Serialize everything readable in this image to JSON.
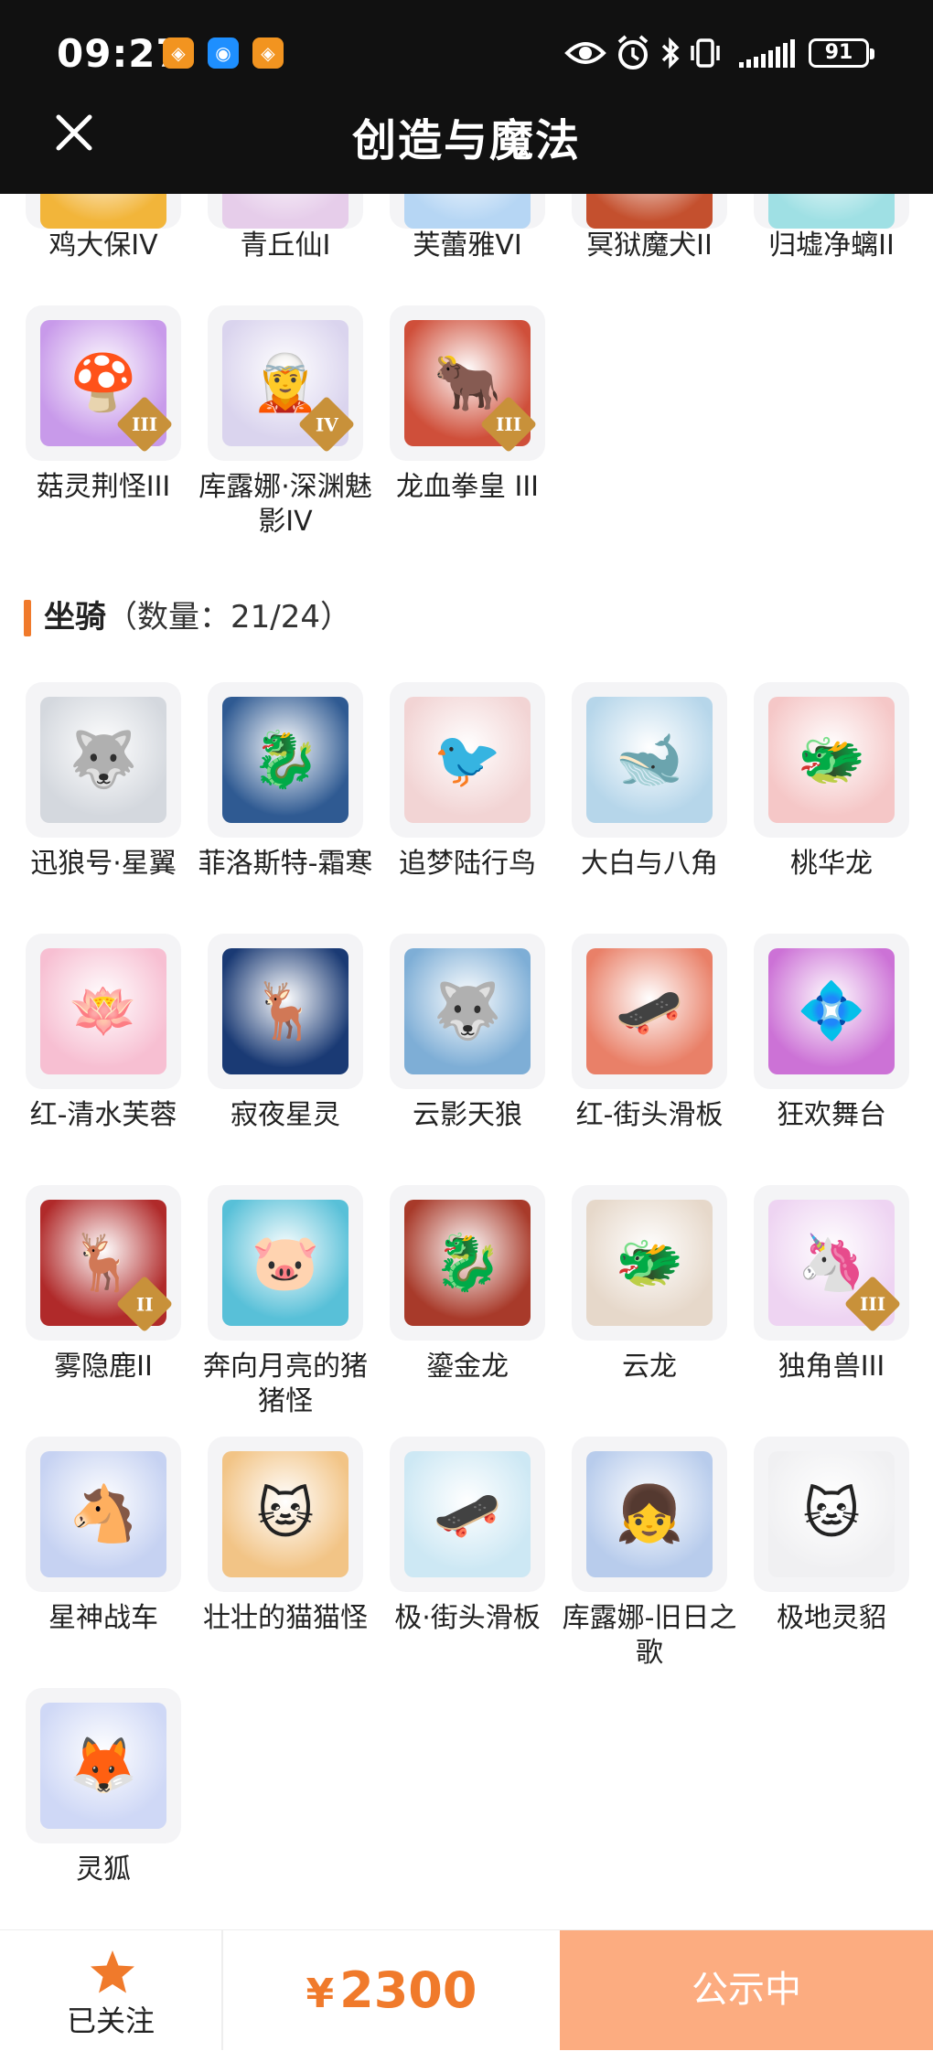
{
  "status_bar": {
    "time": "09:27",
    "battery": "91",
    "app_icons": [
      "orange-app-icon",
      "chat-app-icon",
      "orange-app-icon"
    ],
    "system_icons": [
      "eye-comfort-icon",
      "alarm-icon",
      "bluetooth-icon",
      "vibrate-icon",
      "signal-icon",
      "battery-icon"
    ]
  },
  "header": {
    "title": "创造与魔法",
    "close_icon": "close-icon"
  },
  "partial_row": [
    {
      "label": "鸡大保IV",
      "badge": "IV",
      "color": "#f2b53a"
    },
    {
      "label": "青丘仙I",
      "badge": "I",
      "color": "#e6cdea"
    },
    {
      "label": "芙蕾雅VI",
      "badge": "VI",
      "color": "#b6d6f4"
    },
    {
      "label": "冥狱魔犬II",
      "badge": "II",
      "color": "#c4502e"
    },
    {
      "label": "归墟净螭II",
      "badge": "II",
      "color": "#9fe0e4"
    }
  ],
  "pets_row": [
    {
      "label": "菇灵荆怪III",
      "badge": "III",
      "color": "#c89aea",
      "glyph": "🍄"
    },
    {
      "label": "库露娜·深渊魅影IV",
      "badge": "IV",
      "color": "#dad4ee",
      "glyph": "🧝"
    },
    {
      "label": "龙血拳皇 III",
      "badge": "III",
      "color": "#cf4f3a",
      "glyph": "🐂"
    }
  ],
  "mounts_section": {
    "title": "坐骑",
    "count_text": "（数量：21/24）",
    "items": [
      {
        "label": "迅狼号·星翼",
        "badge": "",
        "color": "#d4d8de",
        "glyph": "🐺"
      },
      {
        "label": "菲洛斯特-霜寒",
        "badge": "",
        "color": "#2f5a92",
        "glyph": "🐉"
      },
      {
        "label": "追梦陆行鸟",
        "badge": "",
        "color": "#f2d4d4",
        "glyph": "🐦"
      },
      {
        "label": "大白与八角",
        "badge": "",
        "color": "#b6d6ea",
        "glyph": "🐋"
      },
      {
        "label": "桃华龙",
        "badge": "",
        "color": "#f5c7c7",
        "glyph": "🐲"
      },
      {
        "label": "红-清水芙蓉",
        "badge": "",
        "color": "#f7bfd2",
        "glyph": "🪷"
      },
      {
        "label": "寂夜星灵",
        "badge": "",
        "color": "#1a3a74",
        "glyph": "🦌"
      },
      {
        "label": "云影天狼",
        "badge": "",
        "color": "#7eaed6",
        "glyph": "🐺"
      },
      {
        "label": "红-街头滑板",
        "badge": "",
        "color": "#e98068",
        "glyph": "🛹"
      },
      {
        "label": "狂欢舞台",
        "badge": "",
        "color": "#cc72d6",
        "glyph": "💠"
      },
      {
        "label": "雾隐鹿II",
        "badge": "II",
        "color": "#b02a2a",
        "glyph": "🦌"
      },
      {
        "label": "奔向月亮的猪猪怪",
        "badge": "",
        "color": "#58c0d8",
        "glyph": "🐷"
      },
      {
        "label": "鎏金龙",
        "badge": "",
        "color": "#a83a2a",
        "glyph": "🐉"
      },
      {
        "label": "云龙",
        "badge": "",
        "color": "#e6d8ca",
        "glyph": "🐲"
      },
      {
        "label": "独角兽III",
        "badge": "III",
        "color": "#eed4f2",
        "glyph": "🦄"
      },
      {
        "label": "星神战车",
        "badge": "",
        "color": "#c6d2f2",
        "glyph": "🐴"
      },
      {
        "label": "壮壮的猫猫怪",
        "badge": "",
        "color": "#f2c486",
        "glyph": "🐱"
      },
      {
        "label": "极·街头滑板",
        "badge": "",
        "color": "#cde8f4",
        "glyph": "🛹"
      },
      {
        "label": "库露娜-旧日之歌",
        "badge": "",
        "color": "#b8ccec",
        "glyph": "👧"
      },
      {
        "label": "极地灵貂",
        "badge": "",
        "color": "#f0f0f2",
        "glyph": "🐱"
      },
      {
        "label": "灵狐",
        "badge": "",
        "color": "#cfd8f6",
        "glyph": "🦊"
      }
    ]
  },
  "bottom_bar": {
    "follow_label": "已关注",
    "currency": "¥",
    "price": "2300",
    "action_label": "公示中",
    "accent": "#f07a2b",
    "action_bg": "#fcac80"
  }
}
